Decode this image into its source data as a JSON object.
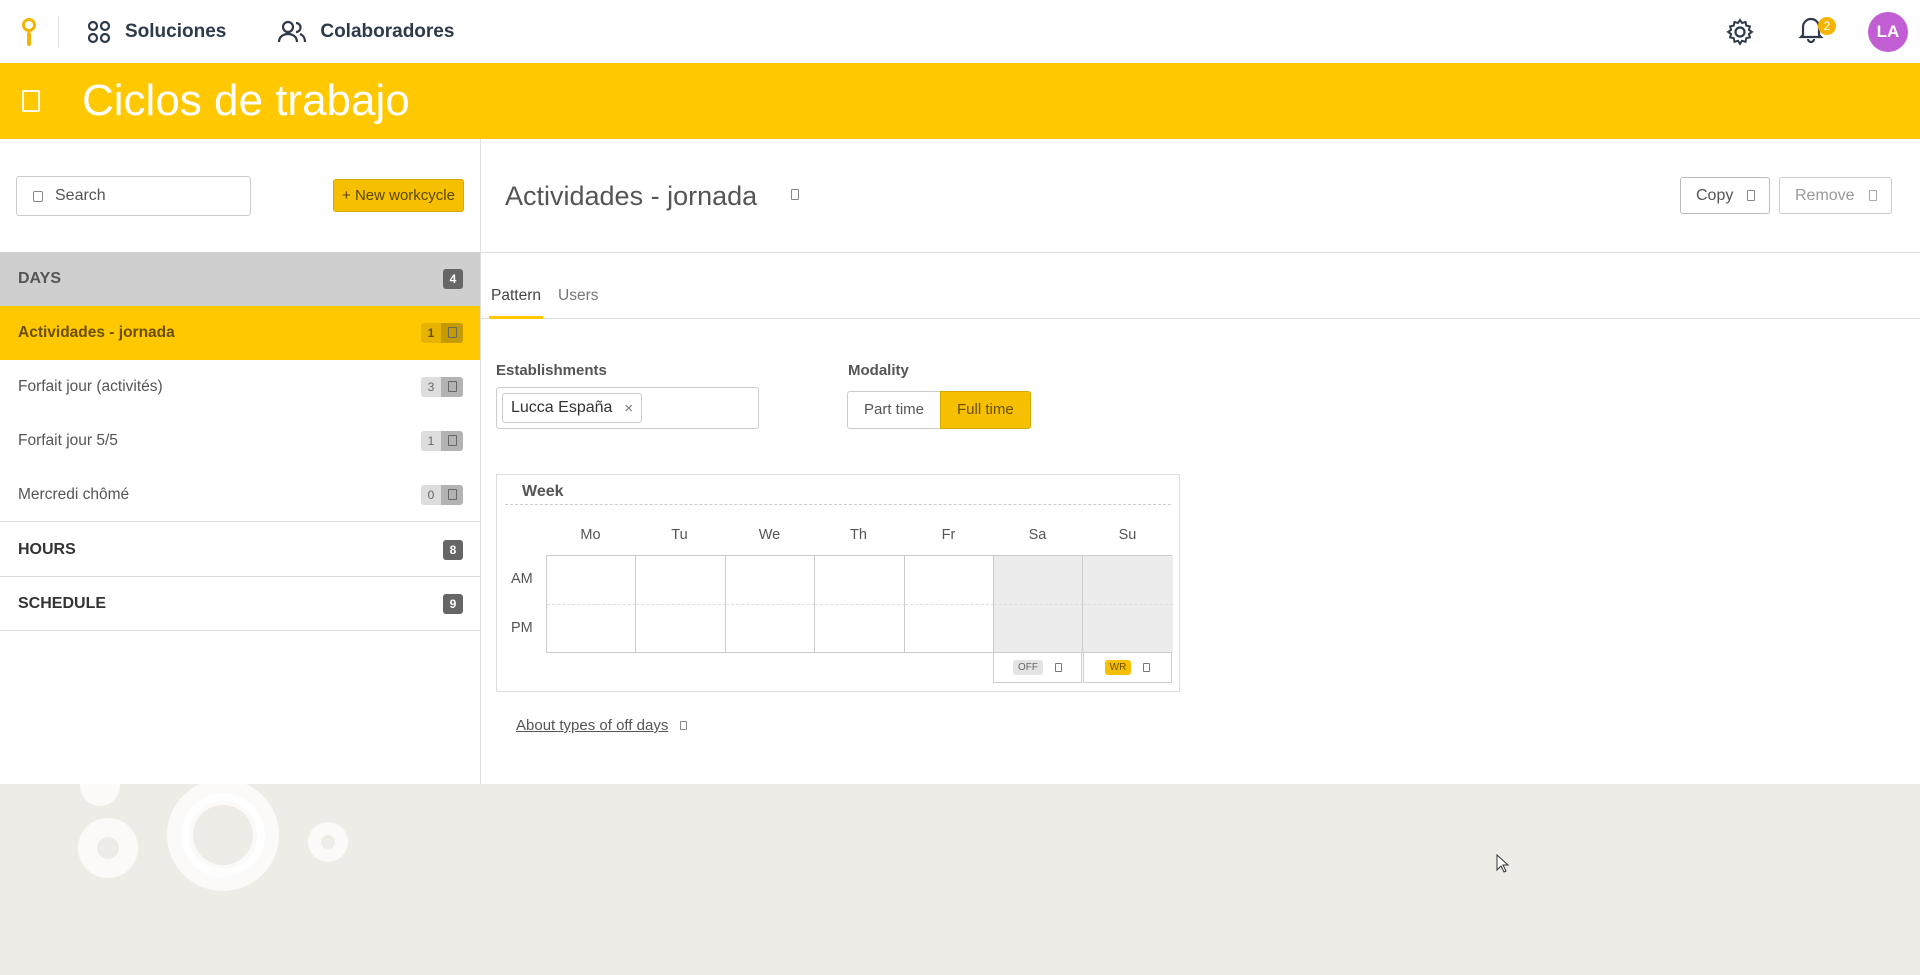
{
  "nav": {
    "solutions": "Soluciones",
    "collaborators": "Colaboradores",
    "notifications_count": "2",
    "avatar_initials": "LA"
  },
  "page": {
    "title": "Ciclos de trabajo"
  },
  "sidebar": {
    "search_placeholder": "Search",
    "new_button": "+ New workcycle",
    "groups": [
      {
        "label": "DAYS",
        "count": "4"
      },
      {
        "label": "HOURS",
        "count": "8"
      },
      {
        "label": "SCHEDULE",
        "count": "9"
      }
    ],
    "items": [
      {
        "label": "Actividades - jornada",
        "count": "1",
        "selected": true
      },
      {
        "label": "Forfait jour (activités)",
        "count": "3"
      },
      {
        "label": "Forfait jour 5/5",
        "count": "1"
      },
      {
        "label": "Mercredi chômé",
        "count": "0"
      }
    ]
  },
  "main": {
    "title": "Actividades - jornada",
    "copy_button": "Copy",
    "remove_button": "Remove",
    "tabs": [
      {
        "label": "Pattern",
        "active": true
      },
      {
        "label": "Users"
      }
    ],
    "establishments_label": "Establishments",
    "establishment_chip": "Lucca España",
    "chip_remove": "×",
    "modality_label": "Modality",
    "modality_options": [
      "Part time",
      "Full time"
    ],
    "modality_selected": "Full time",
    "week": {
      "title": "Week",
      "days": [
        "Mo",
        "Tu",
        "We",
        "Th",
        "Fr",
        "Sa",
        "Su"
      ],
      "rows": [
        "AM",
        "PM"
      ],
      "off_days": [
        {
          "day": "Sa",
          "tag": "OFF"
        },
        {
          "day": "Su",
          "tag": "WR"
        }
      ]
    },
    "about_link": "About types of off days"
  },
  "colors": {
    "brand_yellow": "#ffc800",
    "avatar": "#c15ed3",
    "nav_text": "#2d3a4b"
  }
}
